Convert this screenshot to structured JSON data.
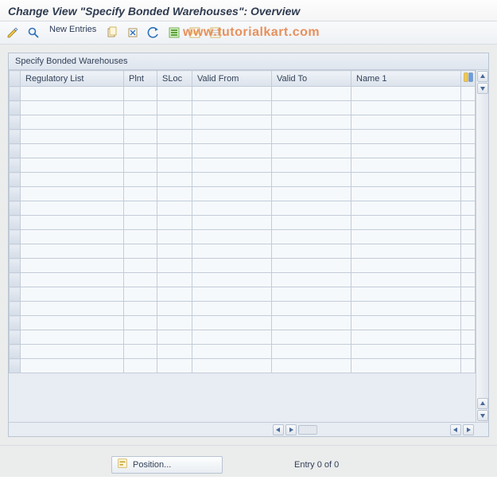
{
  "title": "Change View \"Specify Bonded Warehouses\": Overview",
  "toolbar": {
    "new_entries": "New Entries"
  },
  "watermark": "www.tutorialkart.com",
  "panel": {
    "title": "Specify Bonded Warehouses"
  },
  "columns": {
    "regulatory_list": "Regulatory List",
    "plnt": "Plnt",
    "sloc": "SLoc",
    "valid_from": "Valid From",
    "valid_to": "Valid To",
    "name1": "Name 1"
  },
  "footer": {
    "position": "Position...",
    "entry_text": "Entry 0 of 0"
  }
}
